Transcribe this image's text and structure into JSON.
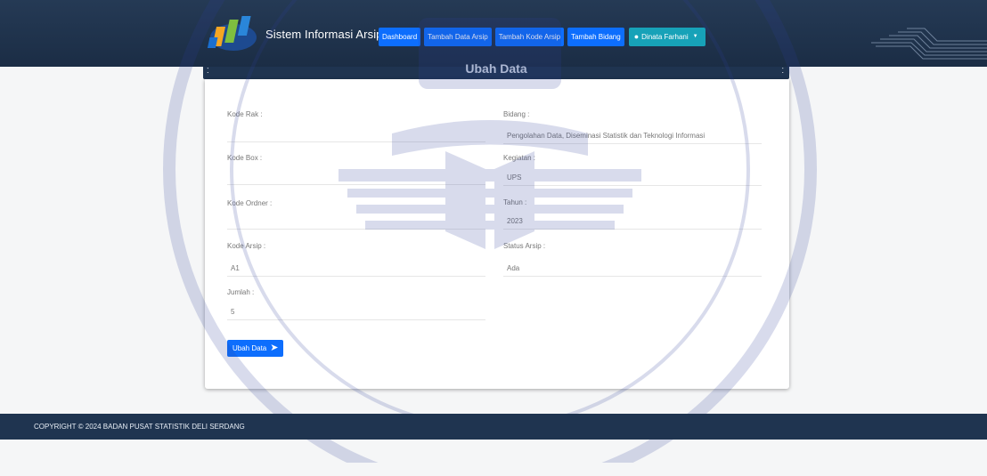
{
  "app": {
    "title": "Sistem Informasi Arsip"
  },
  "nav": {
    "items": [
      {
        "label": "Dashboard"
      },
      {
        "label": "Tambah Data Arsip"
      },
      {
        "label": "Tambah Kode Arsip"
      },
      {
        "label": "Tambah Bidang"
      }
    ],
    "user": {
      "label": "Dinata Farhani",
      "icon": "user-circle-icon"
    }
  },
  "card": {
    "title": "Ubah Data"
  },
  "form": {
    "kode_rak": {
      "label": "Kode Rak :",
      "value": ""
    },
    "kode_box": {
      "label": "Kode Box :",
      "value": ""
    },
    "kode_ordner": {
      "label": "Kode Ordner :",
      "value": ""
    },
    "kode_arsip": {
      "label": "Kode Arsip :",
      "value": "A1"
    },
    "jumlah": {
      "label": "Jumlah :",
      "value": "5"
    },
    "bidang": {
      "label": "Bidang :",
      "value": "Pengolahan Data, Diseminasi Statistik dan Teknologi Informasi"
    },
    "kegiatan": {
      "label": "Kegiatan :",
      "value": "UPS"
    },
    "tahun": {
      "label": "Tahun :",
      "value": "2023"
    },
    "status_arsip": {
      "label": "Status Arsip :",
      "value": "Ada"
    },
    "submit_label": "Ubah Data"
  },
  "footer": {
    "copyright": "COPYRIGHT © 2024 BADAN PUSAT STATISTIK DELI SERDANG"
  },
  "colors": {
    "header": "#1f3450",
    "primary": "#0d6efd",
    "info": "#17a2b8",
    "watermark": "#2d3f9a"
  }
}
